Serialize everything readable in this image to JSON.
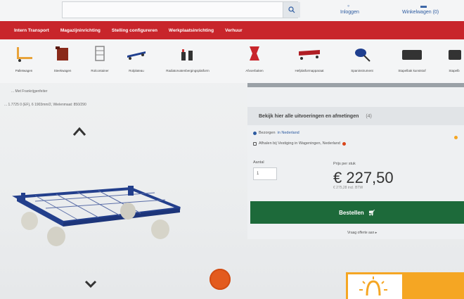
{
  "header": {
    "search_icon": "search-icon",
    "login_label": "Inloggen",
    "cart_label": "Winkelwagen (0)"
  },
  "nav": {
    "items": [
      "Intern Transport",
      "Magazijninrichting",
      "Stelling configureren",
      "Werkplaatsinrichting",
      "Verhuur"
    ]
  },
  "categories": [
    {
      "label": "Palletwagen",
      "icon": "pallet-truck-icon"
    },
    {
      "label": "Steekwagen",
      "icon": "hand-truck-icon"
    },
    {
      "label": "Rolcontainer",
      "icon": "roll-container-icon"
    },
    {
      "label": "Rolplateau",
      "icon": "dolly-icon"
    },
    {
      "label": "Radiatorvatenbergingsplatform",
      "icon": "lifting-tool-icon"
    },
    {
      "label": "Afvoerbaken",
      "icon": "rack-icon"
    },
    {
      "label": "Hefplatformapparaat",
      "icon": "lift-table-icon"
    },
    {
      "label": "Spaninstrument",
      "icon": "strap-icon"
    },
    {
      "label": "Stapelbak kunststof",
      "icon": "crate-icon"
    },
    {
      "label": "Stapelb",
      "icon": "crate-icon"
    }
  ],
  "breadcrumbs": {
    "line1": "... Met Frankrijgenfeiter",
    "line2": "... 1.7725 0 (EF), 6 1903mm/2, Wielenmaat: 850/290"
  },
  "product": {
    "image_icon": "pallet-dolly-image",
    "badge_icon": "discount-badge-icon"
  },
  "purchase": {
    "view_all_label": "Bekijk hier alle uitvoeringen en afmetingen",
    "view_all_count": "(4)",
    "option_1": {
      "label": "Bezorgen",
      "link": "in Nederland"
    },
    "option_2": {
      "label": "Afhalen bij Vestiging in Wageningen, Nederland"
    },
    "qty_label": "Aantal",
    "qty_value": "1",
    "price_label": "Prijs per stuk",
    "price": "€ 227,50",
    "price_sub": "€ 275,28 incl. BTW",
    "order_button": "Bestellen",
    "quote_link": "Vraag offerte aan"
  },
  "colors": {
    "nav_red": "#c8252b",
    "order_green": "#1d6a3a",
    "accent_orange": "#f5a623",
    "link_blue": "#2c5aa0"
  }
}
